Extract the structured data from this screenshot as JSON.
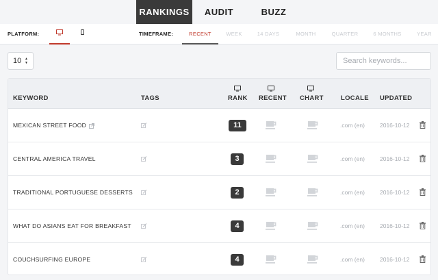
{
  "tabs": [
    {
      "label": "RANKINGS",
      "active": true
    },
    {
      "label": "AUDIT",
      "active": false
    },
    {
      "label": "BUZZ",
      "active": false
    }
  ],
  "filters": {
    "platform_label": "PLATFORM:",
    "platforms": [
      {
        "icon": "desktop-icon",
        "active": true
      },
      {
        "icon": "mobile-icon",
        "active": false
      }
    ],
    "timeframe_label": "TIMEFRAME:",
    "timeframes": [
      "RECENT",
      "WEEK",
      "14 DAYS",
      "MONTH",
      "QUARTER",
      "6 MONTHS",
      "YEAR"
    ],
    "active_timeframe": "RECENT"
  },
  "controls": {
    "per_page": "10",
    "search_placeholder": "Search keywords..."
  },
  "table": {
    "headers": {
      "keyword": "KEYWORD",
      "tags": "TAGS",
      "rank": "RANK",
      "recent": "RECENT",
      "chart": "CHART",
      "locale": "LOCALE",
      "updated": "UPDATED"
    },
    "rows": [
      {
        "keyword": "MEXICAN STREET FOOD",
        "external_link": true,
        "rank": "11",
        "locale": ".com (en)",
        "updated": "2016-10-12"
      },
      {
        "keyword": "CENTRAL AMERICA TRAVEL",
        "external_link": false,
        "rank": "3",
        "locale": ".com (en)",
        "updated": "2016-10-12"
      },
      {
        "keyword": "TRADITIONAL PORTUGUESE DESSERTS",
        "external_link": false,
        "rank": "2",
        "locale": ".com (en)",
        "updated": "2016-10-12"
      },
      {
        "keyword": "WHAT DO ASIANS EAT FOR BREAKFAST",
        "external_link": false,
        "rank": "4",
        "locale": ".com (en)",
        "updated": "2016-10-12"
      },
      {
        "keyword": "COUCHSURFING EUROPE",
        "external_link": false,
        "rank": "4",
        "locale": ".com (en)",
        "updated": "2016-10-12"
      }
    ]
  },
  "colors": {
    "accent": "#c0392b",
    "dark": "#3a3a3a",
    "muted": "#a8acb2",
    "icon_muted": "#d2d5d9"
  }
}
